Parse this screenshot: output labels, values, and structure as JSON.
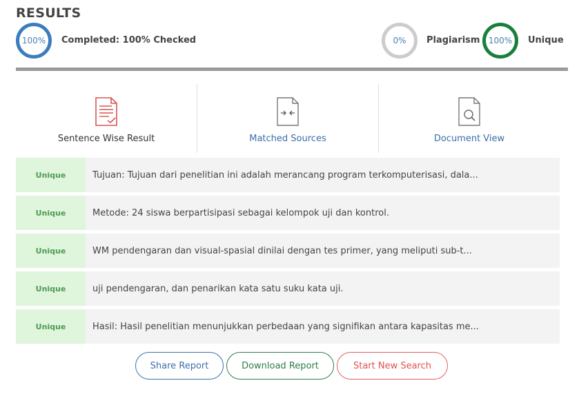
{
  "header": {
    "title": "RESULTS"
  },
  "summary": {
    "completed_percent": "100%",
    "completed_label": "Completed: 100% Checked",
    "plagiarism_percent": "0%",
    "plagiarism_label": "Plagiarism",
    "unique_percent": "100%",
    "unique_label": "Unique",
    "progress": 1.0
  },
  "tabs": [
    {
      "label": "Sentence Wise Result",
      "icon": "document-check-icon",
      "active": true
    },
    {
      "label": "Matched Sources",
      "icon": "compare-arrows-icon",
      "active": false
    },
    {
      "label": "Document View",
      "icon": "document-search-icon",
      "active": false
    }
  ],
  "results": [
    {
      "status": "Unique",
      "sentence": "Tujuan: Tujuan dari penelitian ini adalah merancang program terkomputerisasi, dala..."
    },
    {
      "status": "Unique",
      "sentence": "Metode: 24 siswa berpartisipasi sebagai kelompok uji dan kontrol."
    },
    {
      "status": "Unique",
      "sentence": "WM pendengaran dan visual-spasial dinilai dengan tes primer, yang meliputi sub-t..."
    },
    {
      "status": "Unique",
      "sentence": "uji pendengaran, dan penarikan kata satu suku kata uji."
    },
    {
      "status": "Unique",
      "sentence": "Hasil: Hasil penelitian menunjukkan perbedaan yang signifikan antara kapasitas me..."
    }
  ],
  "actions": {
    "share_label": "Share Report",
    "download_label": "Download Report",
    "new_search_label": "Start New Search"
  },
  "colors": {
    "completed_ring": "#3b7dbd",
    "plagiarism_ring": "#cccccc",
    "unique_ring": "#1a7f3c",
    "unique_badge_bg": "#dff5dc",
    "unique_badge_text": "#4f9a53"
  }
}
